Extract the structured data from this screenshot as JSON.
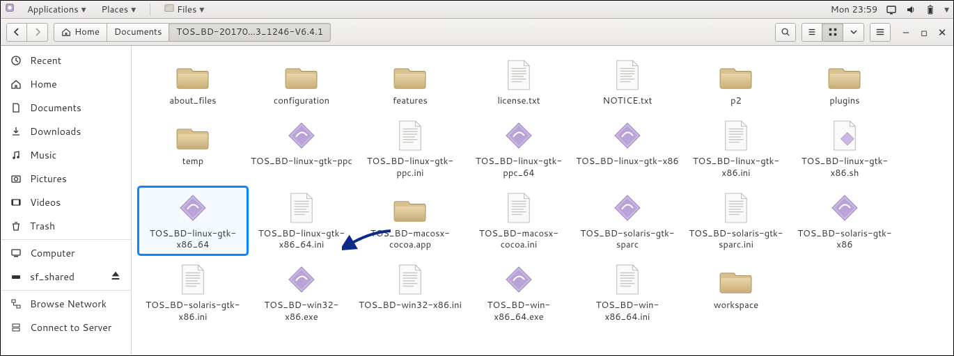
{
  "panel": {
    "applications": "Applications",
    "places": "Places",
    "app_menu": "Files",
    "clock": "Mon 23:59"
  },
  "toolbar": {
    "breadcrumb": {
      "home": "Home",
      "documents": "Documents",
      "current": "TOS_BD-20170…3_1246-V6.4.1"
    }
  },
  "sidebar": {
    "items": [
      {
        "label": "Recent"
      },
      {
        "label": "Home"
      },
      {
        "label": "Documents"
      },
      {
        "label": "Downloads"
      },
      {
        "label": "Music"
      },
      {
        "label": "Pictures"
      },
      {
        "label": "Videos"
      },
      {
        "label": "Trash"
      },
      {
        "label": "Computer"
      },
      {
        "label": "sf_shared"
      },
      {
        "label": "Browse Network"
      },
      {
        "label": "Connect to Server"
      }
    ]
  },
  "files": {
    "items": [
      {
        "name": "about_files",
        "type": "folder"
      },
      {
        "name": "configuration",
        "type": "folder"
      },
      {
        "name": "features",
        "type": "folder"
      },
      {
        "name": "license.txt",
        "type": "text"
      },
      {
        "name": "NOTICE.txt",
        "type": "text"
      },
      {
        "name": "p2",
        "type": "folder"
      },
      {
        "name": "plugins",
        "type": "folder"
      },
      {
        "name": "temp",
        "type": "folder"
      },
      {
        "name": "TOS_BD-linux-gtk-ppc",
        "type": "exec"
      },
      {
        "name": "TOS_BD-linux-gtk-ppc.ini",
        "type": "text"
      },
      {
        "name": "TOS_BD-linux-gtk-ppc_64",
        "type": "exec"
      },
      {
        "name": "TOS_BD-linux-gtk-x86",
        "type": "exec"
      },
      {
        "name": "TOS_BD-linux-gtk-x86.ini",
        "type": "text"
      },
      {
        "name": "TOS_BD-linux-gtk-x86.sh",
        "type": "text-exec"
      },
      {
        "name": "TOS_BD-linux-gtk-x86_64",
        "type": "exec",
        "highlight": true
      },
      {
        "name": "TOS_BD-linux-gtk-x86_64.ini",
        "type": "text"
      },
      {
        "name": "TOS_BD-macosx-cocoa.app",
        "type": "folder"
      },
      {
        "name": "TOS_BD-macosx-cocoa.ini",
        "type": "text"
      },
      {
        "name": "TOS_BD-solaris-gtk-sparc",
        "type": "exec"
      },
      {
        "name": "TOS_BD-solaris-gtk-sparc.ini",
        "type": "text"
      },
      {
        "name": "TOS_BD-solaris-gtk-x86",
        "type": "exec"
      },
      {
        "name": "TOS_BD-solaris-gtk-x86.ini",
        "type": "text"
      },
      {
        "name": "TOS_BD-win32-x86.exe",
        "type": "exec"
      },
      {
        "name": "TOS_BD-win32-x86.ini",
        "type": "text"
      },
      {
        "name": "TOS_BD-win-x86_64.exe",
        "type": "exec"
      },
      {
        "name": "TOS_BD-win-x86_64.ini",
        "type": "text"
      },
      {
        "name": "workspace",
        "type": "folder"
      }
    ]
  }
}
